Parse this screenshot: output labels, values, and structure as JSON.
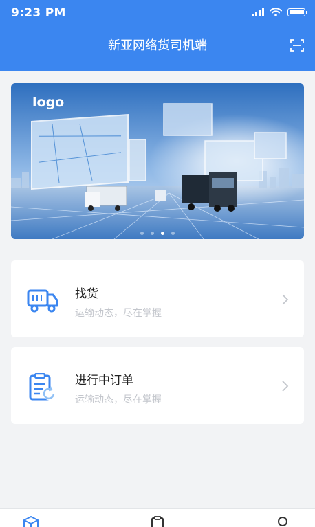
{
  "status_bar": {
    "time": "9:23 PM"
  },
  "header": {
    "title": "新亚网络货司机端",
    "scan_icon": "scan-icon"
  },
  "banner": {
    "logo_text": "logo",
    "dots_count": 4,
    "active_dot": 2
  },
  "cards": [
    {
      "title": "找货",
      "subtitle": "运输动态，尽在掌握",
      "icon": "delivery-truck-icon"
    },
    {
      "title": "进行中订单",
      "subtitle": "运输动态，尽在掌握",
      "icon": "clipboard-refresh-icon"
    }
  ],
  "tabbar": {
    "tabs": [
      {
        "icon": "box-icon"
      },
      {
        "icon": "clipboard-icon"
      },
      {
        "icon": "user-icon"
      }
    ]
  },
  "colors": {
    "primary": "#3b86f0",
    "background": "#f2f3f5",
    "subtitle": "#c3c6cc"
  }
}
